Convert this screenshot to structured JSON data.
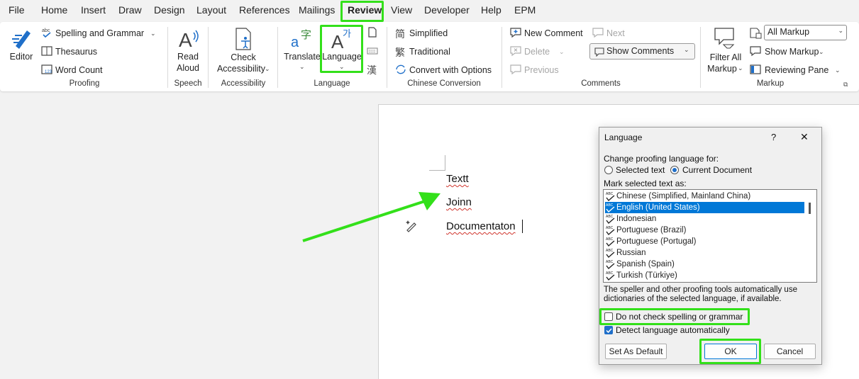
{
  "menubar": {
    "tabs": [
      "File",
      "Home",
      "Insert",
      "Draw",
      "Design",
      "Layout",
      "References",
      "Mailings",
      "Review",
      "View",
      "Developer",
      "Help",
      "EPM"
    ],
    "active_tab": "Review"
  },
  "ribbon": {
    "proofing": {
      "editor": "Editor",
      "spelling": "Spelling and Grammar",
      "thesaurus": "Thesaurus",
      "word_count": "Word Count",
      "label": "Proofing"
    },
    "speech": {
      "read_aloud_1": "Read",
      "read_aloud_2": "Aloud",
      "label": "Speech"
    },
    "accessibility": {
      "check_1": "Check",
      "check_2": "Accessibility",
      "label": "Accessibility"
    },
    "language": {
      "translate": "Translate",
      "language": "Language",
      "label": "Language"
    },
    "chinese": {
      "simplified": "Simplified",
      "traditional": "Traditional",
      "convert": "Convert with Options",
      "label": "Chinese Conversion"
    },
    "comments": {
      "new_comment": "New Comment",
      "delete": "Delete",
      "previous": "Previous",
      "next": "Next",
      "show_comments": "Show Comments",
      "label": "Comments"
    },
    "markup": {
      "filter_1": "Filter All",
      "filter_2": "Markup",
      "all_markup": "All Markup",
      "show_markup": "Show Markup",
      "reviewing_pane": "Reviewing Pane",
      "label": "Markup"
    }
  },
  "document": {
    "lines": [
      "Textt",
      "Joinn",
      "Documentaton"
    ]
  },
  "dialog": {
    "title": "Language",
    "help": "?",
    "close": "✕",
    "change_label": "Change proofing language for:",
    "radio_selected": "Selected text",
    "radio_current": "Current Document",
    "mark_label": "Mark selected text as:",
    "languages": [
      "Chinese (Simplified, Mainland China)",
      "English (United States)",
      "Indonesian",
      "Portuguese (Brazil)",
      "Portuguese (Portugal)",
      "Russian",
      "Spanish (Spain)",
      "Turkish (Türkiye)"
    ],
    "selected_language": "English (United States)",
    "info_1": "The speller and other proofing tools automatically use",
    "info_2": "dictionaries of the selected language, if available.",
    "no_check": "Do not check spelling or grammar",
    "detect": "Detect language automatically",
    "set_default": "Set As Default",
    "ok": "OK",
    "cancel": "Cancel"
  },
  "colors": {
    "highlight": "#33e01a",
    "selection": "#0078d7",
    "accent": "#1f6fc9"
  }
}
